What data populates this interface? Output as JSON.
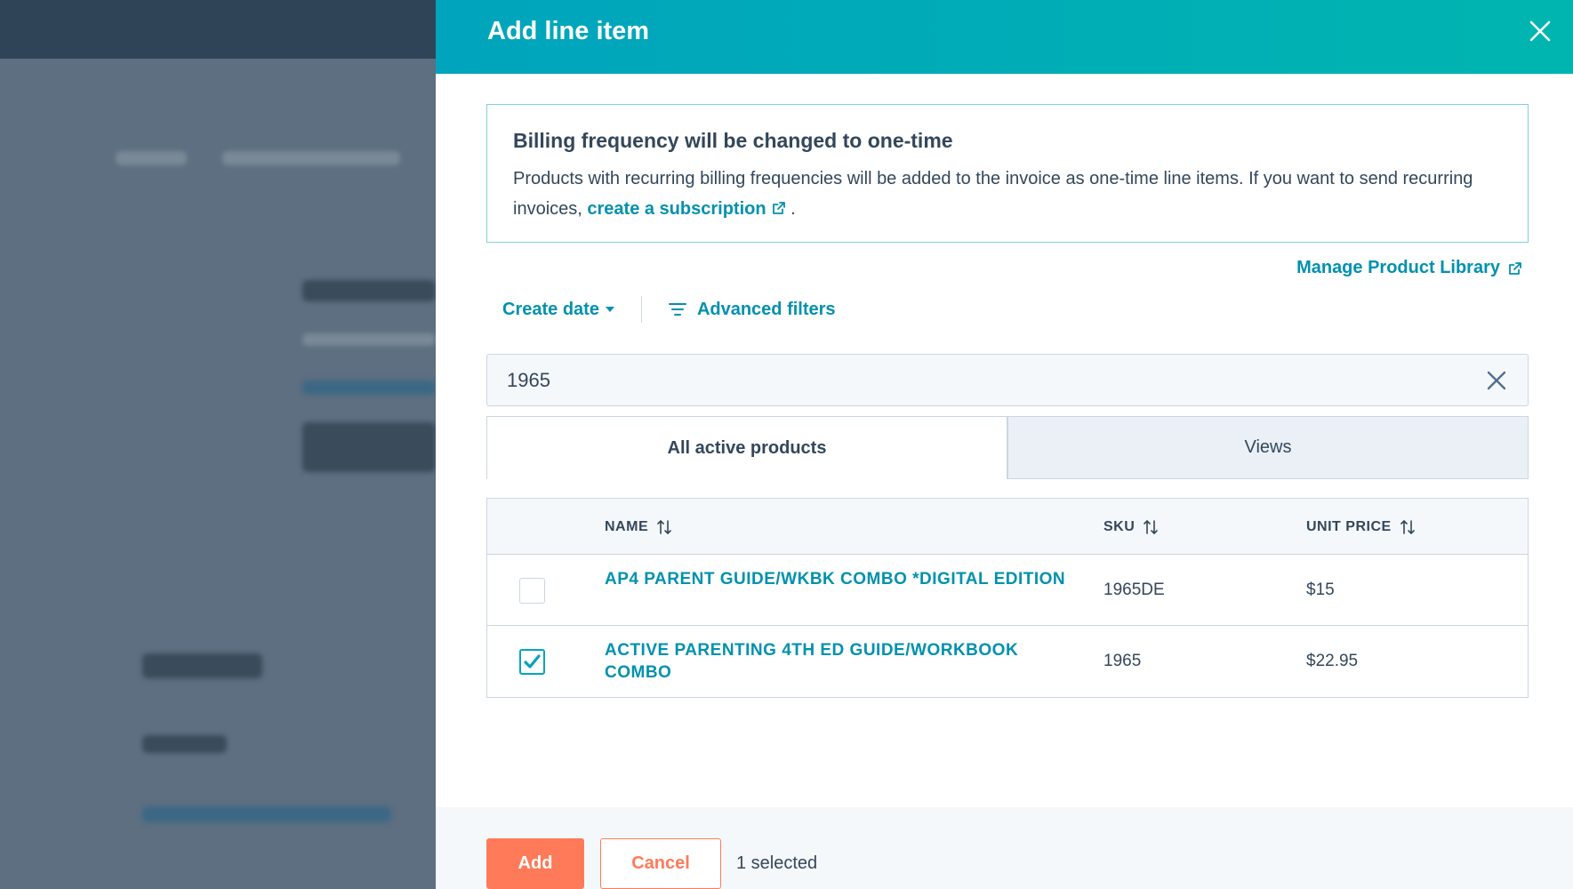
{
  "panel": {
    "title": "Add line item",
    "close_icon": "close-icon"
  },
  "alert": {
    "title": "Billing frequency will be changed to one-time",
    "body_prefix": "Products with recurring billing frequencies will be added to the invoice as one-time line items. If you want to send recurring invoices,",
    "link_text": "create a subscription",
    "body_suffix": "."
  },
  "manage_link": "Manage Product Library",
  "filters": {
    "create_date": "Create date",
    "advanced": "Advanced filters"
  },
  "search": {
    "value": "1965"
  },
  "tabs": [
    {
      "label": "All active products",
      "active": true
    },
    {
      "label": "Views",
      "active": false
    }
  ],
  "table": {
    "columns": [
      "NAME",
      "SKU",
      "UNIT PRICE"
    ],
    "rows": [
      {
        "name": "AP4 PARENT GUIDE/WKBK COMBO *DIGITAL EDITION",
        "sku": "1965DE",
        "price": "$15",
        "checked": false
      },
      {
        "name": "ACTIVE PARENTING 4TH ED GUIDE/WORKBOOK COMBO",
        "sku": "1965",
        "price": "$22.95",
        "checked": true
      }
    ]
  },
  "footer": {
    "add_label": "Add",
    "cancel_label": "Cancel",
    "selected_text": "1 selected"
  },
  "colors": {
    "accent": "#00a4bd",
    "link": "#0091ae",
    "primary_button": "#ff7a59"
  }
}
